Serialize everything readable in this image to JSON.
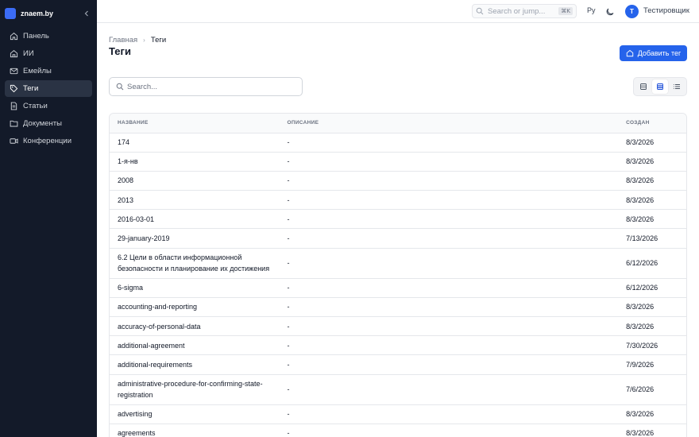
{
  "app": {
    "name": "znaem.by"
  },
  "sidebar": {
    "items": [
      {
        "label": "Панель",
        "icon": "home-icon"
      },
      {
        "label": "ИИ",
        "icon": "ai-home-icon"
      },
      {
        "label": "Емейлы",
        "icon": "mail-icon"
      },
      {
        "label": "Теги",
        "icon": "tag-icon",
        "active": true
      },
      {
        "label": "Статьи",
        "icon": "document-icon"
      },
      {
        "label": "Документы",
        "icon": "folder-icon"
      },
      {
        "label": "Конференции",
        "icon": "video-icon"
      }
    ]
  },
  "topbar": {
    "search_placeholder": "Search or jump...",
    "shortcut": "⌘K",
    "language": "Ру",
    "avatar_initial": "Т",
    "username": "Тестировщик"
  },
  "breadcrumb": {
    "home": "Главная",
    "current": "Теги"
  },
  "page": {
    "title": "Теги",
    "add_button": "Добавить тег",
    "search_placeholder": "Search..."
  },
  "table": {
    "columns": [
      "НАЗВАНИЕ",
      "ОПИСАНИЕ",
      "СОЗДАН"
    ],
    "rows": [
      {
        "name": "174",
        "description": "-",
        "created": "8/3/2026"
      },
      {
        "name": "1-я-нв",
        "description": "-",
        "created": "8/3/2026"
      },
      {
        "name": "2008",
        "description": "-",
        "created": "8/3/2026"
      },
      {
        "name": "2013",
        "description": "-",
        "created": "8/3/2026"
      },
      {
        "name": "2016-03-01",
        "description": "-",
        "created": "8/3/2026"
      },
      {
        "name": "29-january-2019",
        "description": "-",
        "created": "7/13/2026"
      },
      {
        "name": "6.2 Цели в области информационной безопасности и планирование их достижения",
        "description": "-",
        "created": "6/12/2026"
      },
      {
        "name": "6-sigma",
        "description": "-",
        "created": "6/12/2026"
      },
      {
        "name": "accounting-and-reporting",
        "description": "-",
        "created": "8/3/2026"
      },
      {
        "name": "accuracy-of-personal-data",
        "description": "-",
        "created": "8/3/2026"
      },
      {
        "name": "additional-agreement",
        "description": "-",
        "created": "7/30/2026"
      },
      {
        "name": "additional-requirements",
        "description": "-",
        "created": "7/9/2026"
      },
      {
        "name": "administrative-procedure-for-confirming-state-registration",
        "description": "-",
        "created": "7/6/2026"
      },
      {
        "name": "advertising",
        "description": "-",
        "created": "8/3/2026"
      },
      {
        "name": "agreements",
        "description": "-",
        "created": "8/3/2026"
      }
    ]
  },
  "colors": {
    "sidebar_bg": "#131a29",
    "accent": "#2563eb",
    "active_item": "#2a3344"
  }
}
